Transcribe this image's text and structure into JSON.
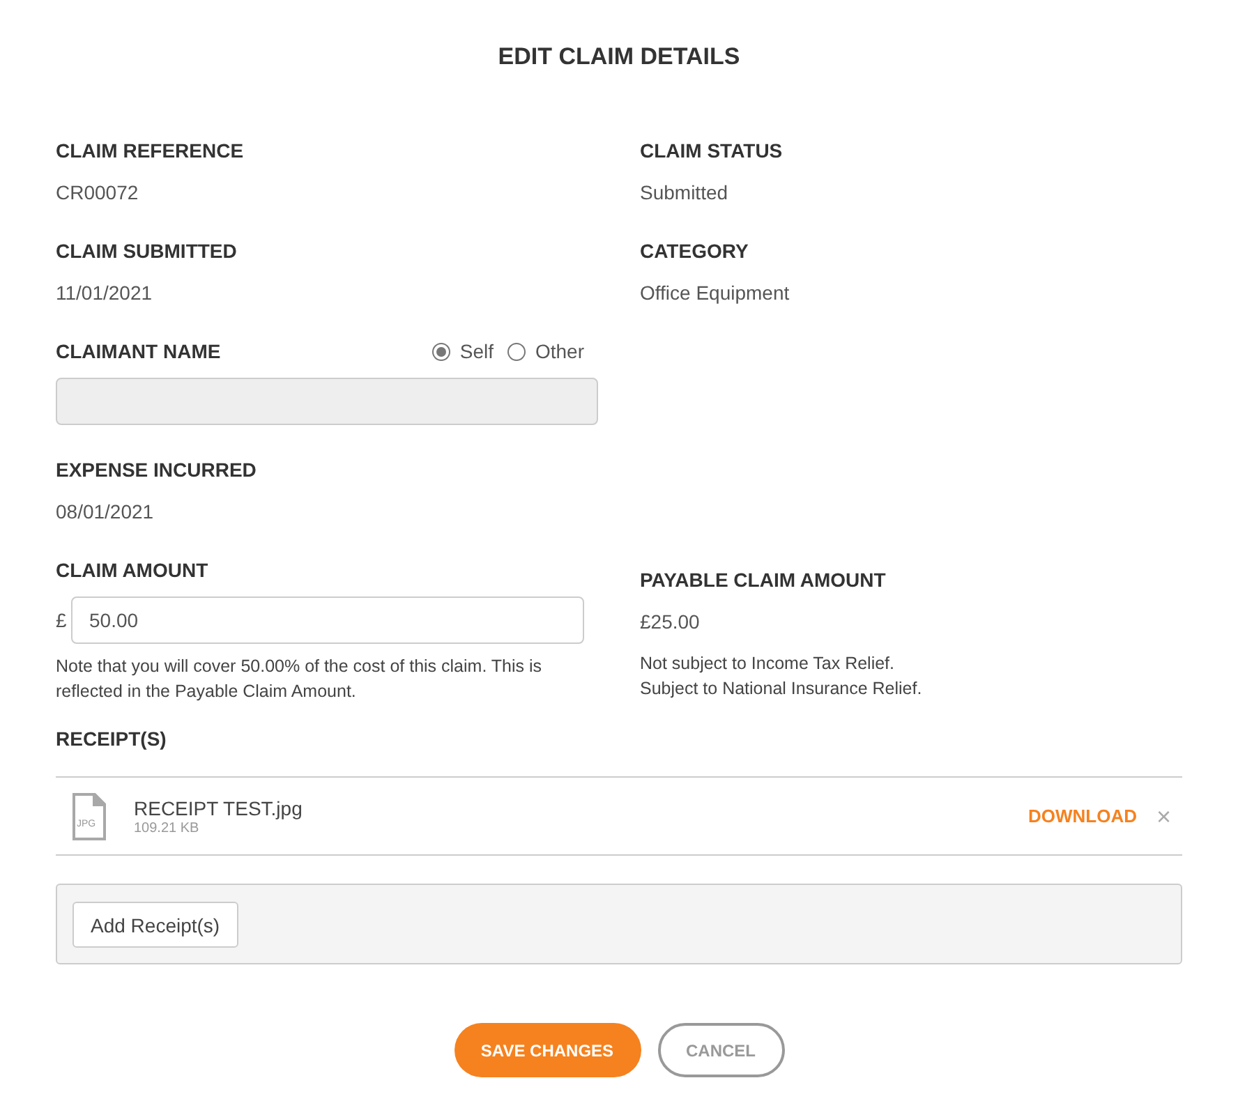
{
  "title": "EDIT CLAIM DETAILS",
  "info_rows": [
    [
      {
        "label": "CLAIM REFERENCE",
        "value": "CR00072"
      },
      {
        "label": "CLAIM STATUS",
        "value": "Submitted"
      }
    ],
    [
      {
        "label": "CLAIM SUBMITTED",
        "value": "11/01/2021"
      },
      {
        "label": "CATEGORY",
        "value": "Office Equipment"
      }
    ]
  ],
  "claimant": {
    "label": "CLAIMANT NAME",
    "options": [
      {
        "label": "Self",
        "selected": true
      },
      {
        "label": "Other",
        "selected": false
      }
    ],
    "disabled": true
  },
  "expense_incurred": {
    "label": "EXPENSE INCURRED",
    "value": "08/01/2021"
  },
  "claim_amount": {
    "label": "CLAIM AMOUNT",
    "currency": "£",
    "value": "50.00",
    "note": "Note that you will cover 50.00% of the cost of this claim. This is reflected in the Payable Claim Amount."
  },
  "payable_claim_amount": {
    "label": "PAYABLE CLAIM AMOUNT",
    "value": "£25.00",
    "notes": [
      "Not subject to Income Tax Relief.",
      "Subject to National Insurance Relief."
    ]
  },
  "receipts": {
    "label": "RECEIPT(S)",
    "files": [
      {
        "type": "JPG",
        "name": "RECEIPT TEST.jpg",
        "size": "109.21 KB",
        "download": "DOWNLOAD",
        "remove": "×"
      }
    ],
    "add_button": "Add Receipt(s)"
  },
  "buttons": [
    {
      "label": "SAVE CHANGES",
      "kind": "primary"
    },
    {
      "label": "CANCEL",
      "kind": "secondary"
    }
  ]
}
